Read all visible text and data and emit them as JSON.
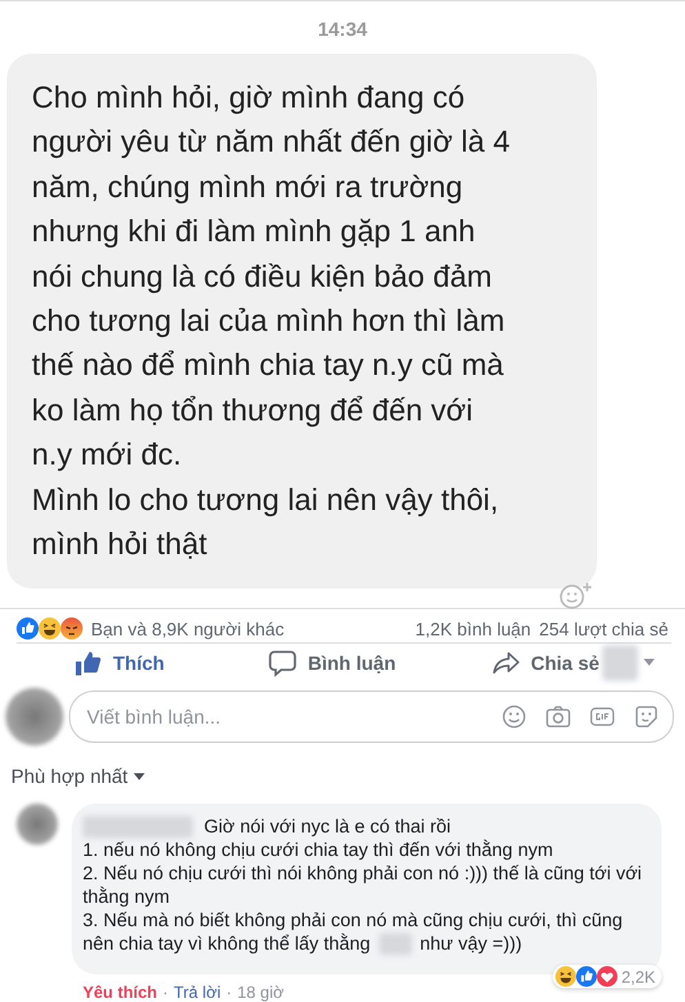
{
  "timestamp": "14:34",
  "message": {
    "lines": [
      "Cho mình hỏi, giờ mình đang có",
      "người yêu từ năm nhất đến giờ là 4",
      "năm, chúng mình mới ra trường",
      "nhưng khi đi làm mình gặp 1 anh",
      "nói chung là có điều kiện bảo đảm",
      "cho tương lai của mình hơn thì làm",
      "thế nào để mình chia tay n.y cũ mà",
      "ko làm họ tổn thương để đến với",
      "n.y mới đc.",
      "Mình lo cho tương lai nên vậy thôi,",
      "mình hỏi thật"
    ]
  },
  "stats": {
    "reaction_icons": [
      {
        "kind": "like"
      },
      {
        "kind": "haha"
      },
      {
        "kind": "angry"
      }
    ],
    "likes_text": "Bạn và 8,9K người khác",
    "comments_count": "1,2K bình luận",
    "shares_count": "254 lượt chia sẻ"
  },
  "actions": [
    {
      "kind": "like",
      "label": "Thích",
      "selected": true
    },
    {
      "kind": "comment",
      "label": "Bình luận",
      "selected": false
    },
    {
      "kind": "share",
      "label": "Chia sẻ",
      "selected": false
    }
  ],
  "comment_box": {
    "placeholder": "Viết bình luận..."
  },
  "sort": {
    "label": "Phù hợp nhất"
  },
  "comment": {
    "first_line": "Giờ nói với nyc là e có thai rồi",
    "lines": [
      "1. nếu nó không chịu cưới chia tay thì đến với thằng nym",
      "2. Nếu nó chịu cưới thì nói không phải con nó :))) thế là cũng tới với",
      "thằng nym",
      "3. Nếu mà nó biết không phải con nó mà cũng chịu cưới, thì cũng"
    ],
    "last_line_before": "nên chia tay vì không thể lấy thằng",
    "last_line_after": "như vậy =)))",
    "reaction_icons": [
      {
        "kind": "haha"
      },
      {
        "kind": "like"
      },
      {
        "kind": "love"
      }
    ],
    "reaction_count": "2,2K",
    "footer": [
      {
        "kind": "link",
        "text": "Yêu thích",
        "selected": true
      },
      {
        "kind": "dot",
        "text": "·"
      },
      {
        "kind": "link",
        "text": "Trả lời",
        "selected": false
      },
      {
        "kind": "dot",
        "text": "·"
      },
      {
        "kind": "time",
        "text": "18 giờ"
      }
    ]
  }
}
